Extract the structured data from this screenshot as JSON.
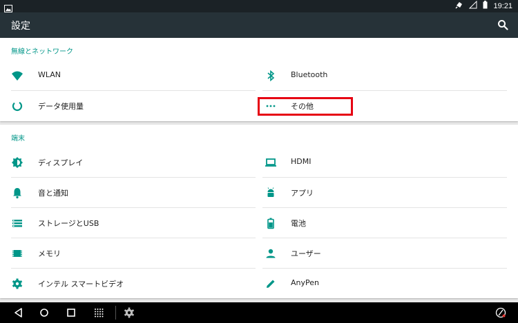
{
  "status_bar": {
    "time": "19:21"
  },
  "app_bar": {
    "title": "設定",
    "search_icon": "search-icon"
  },
  "sections": [
    {
      "header": "無線とネットワーク",
      "items": [
        {
          "label": "WLAN",
          "icon": "wifi-icon"
        },
        {
          "label": "Bluetooth",
          "icon": "bluetooth-icon"
        },
        {
          "label": "データ使用量",
          "icon": "data-usage-icon"
        },
        {
          "label": "その他",
          "icon": "more-icon"
        }
      ]
    },
    {
      "header": "端末",
      "items": [
        {
          "label": "ディスプレイ",
          "icon": "brightness-icon"
        },
        {
          "label": "HDMI",
          "icon": "laptop-icon"
        },
        {
          "label": "音と通知",
          "icon": "bell-icon"
        },
        {
          "label": "アプリ",
          "icon": "android-icon"
        },
        {
          "label": "ストレージとUSB",
          "icon": "storage-icon"
        },
        {
          "label": "電池",
          "icon": "battery-icon"
        },
        {
          "label": "メモリ",
          "icon": "memory-icon"
        },
        {
          "label": "ユーザー",
          "icon": "person-icon"
        },
        {
          "label": "インテル スマートビデオ",
          "icon": "gear-icon"
        },
        {
          "label": "AnyPen",
          "icon": "pen-icon"
        }
      ]
    }
  ],
  "colors": {
    "accent": "#009688",
    "app_bar": "#263238",
    "status_bar": "#1b2226",
    "highlight": "#e60012"
  }
}
